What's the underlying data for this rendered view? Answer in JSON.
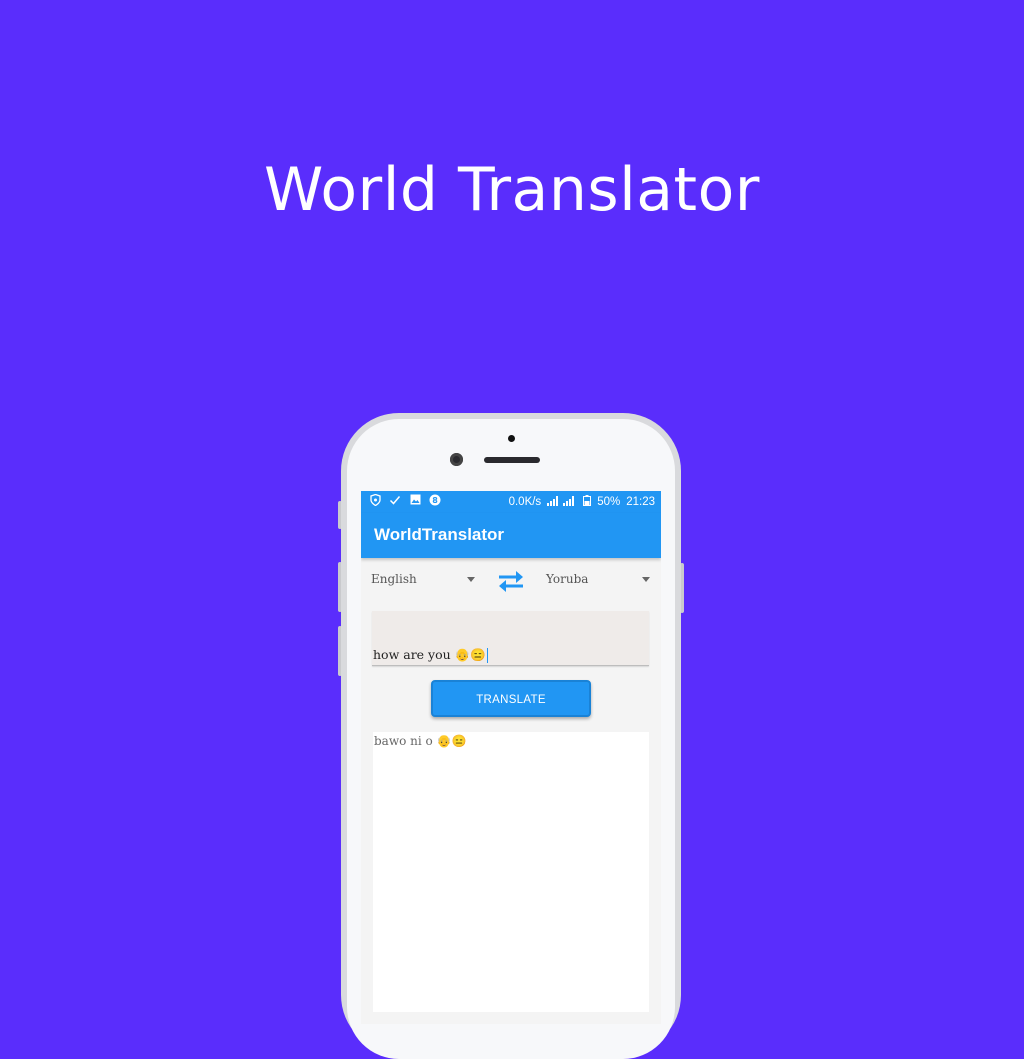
{
  "headline": "World Translator",
  "colors": {
    "background": "#5a2dfc",
    "primary": "#2196f3"
  },
  "status_bar": {
    "icons": [
      "shield-icon",
      "check-icon",
      "image-icon",
      "vpn-icon"
    ],
    "speed": "0.0K/s",
    "battery": "50%",
    "time": "21:23"
  },
  "app": {
    "title": "WorldTranslator",
    "source_language": "English",
    "target_language": "Yoruba",
    "swap_icon": "swap-arrows-icon",
    "input_text": "how are you 👴😑",
    "translate_label": "TRANSLATE",
    "output_text": "bawo ni o 👴😑"
  }
}
